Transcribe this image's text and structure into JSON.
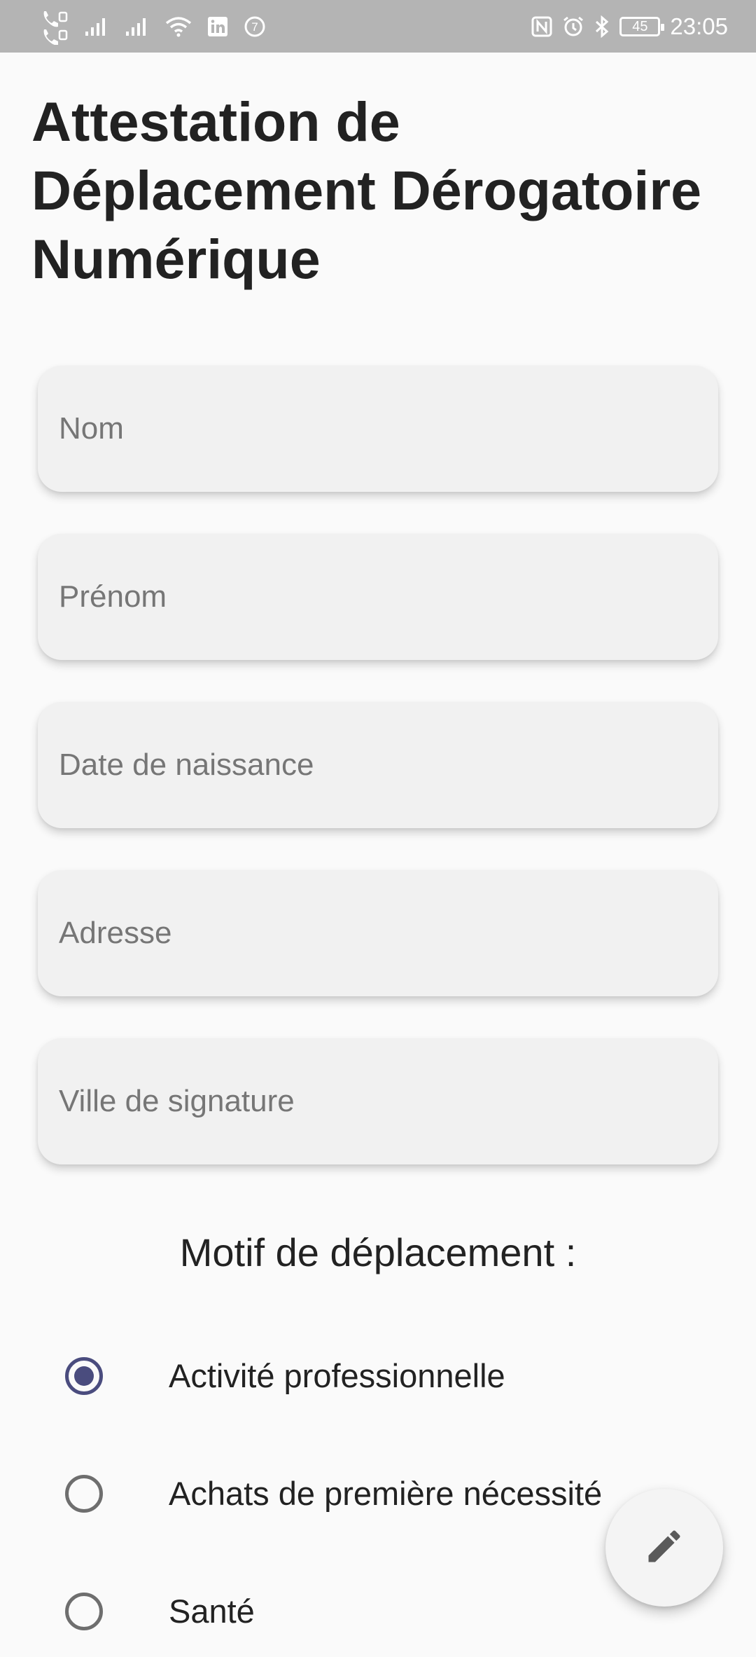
{
  "status_bar": {
    "time": "23:05",
    "battery_level": "45",
    "left_icons": [
      "wifi-call-1-icon",
      "wifi-call-2-icon",
      "signal-1-icon",
      "signal-2-icon",
      "wifi-icon",
      "linkedin-icon",
      "notification-7-icon"
    ],
    "notification_count": "7",
    "right_icons": [
      "nfc-icon",
      "alarm-icon",
      "bluetooth-icon",
      "battery-icon"
    ]
  },
  "header": {
    "title": "Attestation de Déplacement Dérogatoire Numérique"
  },
  "form": {
    "nom_placeholder": "Nom",
    "prenom_placeholder": "Prénom",
    "date_naissance_placeholder": "Date de naissance",
    "adresse_placeholder": "Adresse",
    "ville_signature_placeholder": "Ville de signature"
  },
  "motif": {
    "title": "Motif de déplacement :",
    "selected": "Activité professionnelle",
    "options": [
      {
        "label": "Activité professionnelle",
        "checked": true
      },
      {
        "label": "Achats de première nécessité",
        "checked": false
      },
      {
        "label": "Santé",
        "checked": false
      }
    ]
  },
  "fab": {
    "icon": "edit-pencil-icon"
  },
  "colors": {
    "accent": "#4a4c7e",
    "status_bar": "#b4b4b4",
    "field_background": "#f1f1f1",
    "page_background": "#fafafa"
  }
}
